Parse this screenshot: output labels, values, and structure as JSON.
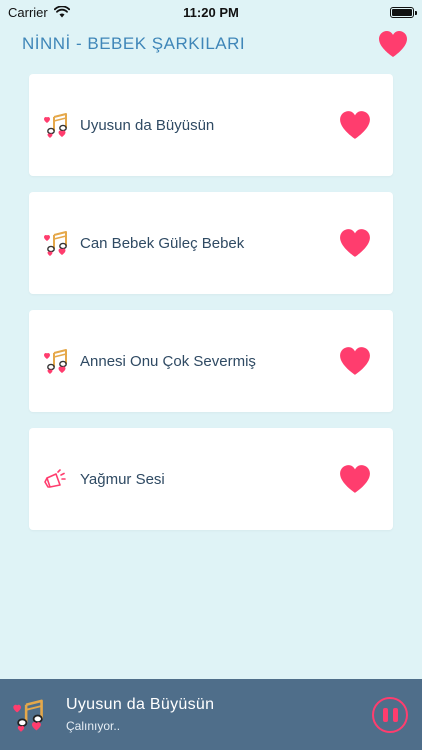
{
  "status_bar": {
    "carrier": "Carrier",
    "time": "11:20 PM",
    "battery_level": 1.0
  },
  "header": {
    "title": "NİNNİ - BEBEK ŞARKILARI",
    "favorites_icon": "heart-icon"
  },
  "songs": [
    {
      "label": "Uyusun da Büyüsün",
      "icon": "music-note-hearts-icon",
      "favorite": true
    },
    {
      "label": "Can Bebek Güleç Bebek",
      "icon": "music-note-hearts-icon",
      "favorite": true
    },
    {
      "label": "Annesi Onu Çok Severmiş",
      "icon": "music-note-hearts-icon",
      "favorite": true
    },
    {
      "label": "Yağmur Sesi",
      "icon": "megaphone-icon",
      "favorite": true
    }
  ],
  "player": {
    "title": "Uyusun da Büyüsün",
    "status": "Çalınıyor..",
    "icon": "music-note-hearts-icon",
    "control": "pause-icon"
  },
  "colors": {
    "background": "#dff3f6",
    "accent": "#ff3d6e",
    "title_blue": "#3f86b8",
    "player_bg": "#4f6e8a",
    "card_bg": "#ffffff"
  }
}
